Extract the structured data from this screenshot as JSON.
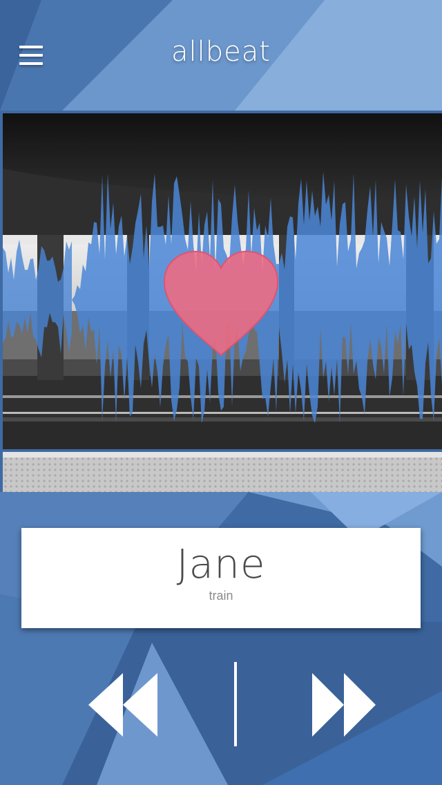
{
  "header": {
    "title": "allbeat",
    "menu_icon": "hamburger-menu-icon"
  },
  "artwork": {
    "description_icon": "subway-station-photo",
    "visualizer": "audio-waveform",
    "favorite_icon": "heart-icon"
  },
  "track": {
    "title": "Jane",
    "subtitle": "train"
  },
  "controls": {
    "previous_icon": "rewind-icon",
    "next_icon": "fast-forward-icon"
  },
  "colors": {
    "background": "#3f6aa3",
    "waveform": "#4a86d6",
    "heart": "#f06b82",
    "card": "#ffffff"
  }
}
